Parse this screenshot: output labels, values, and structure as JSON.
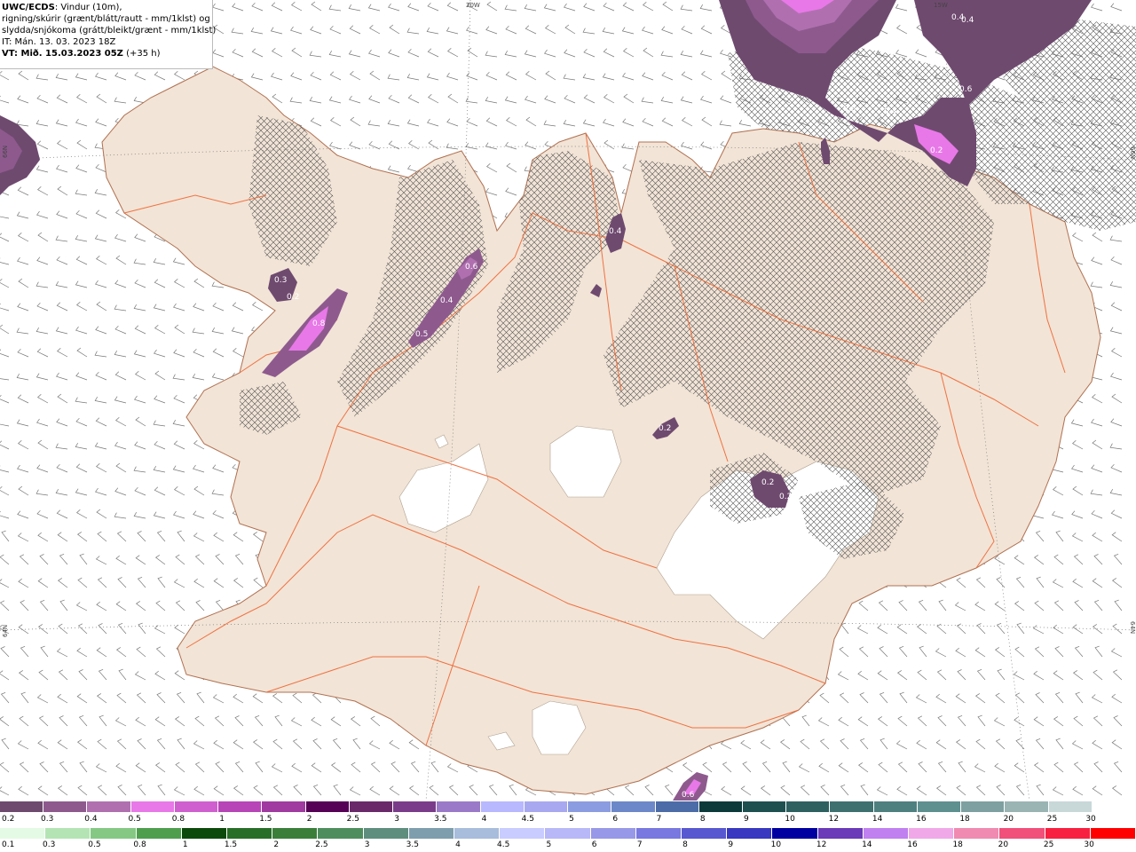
{
  "header": {
    "product_bold": "UWC/ECDS",
    "product_rest": ": Vindur (10m),",
    "line2": "rigning/skúrir (grænt/blátt/rautt - mm/1klst) og",
    "line3": "slydda/snjókoma (grátt/bleikt/grænt - mm/1klst)",
    "issue_time": "IT: Mán. 13. 03. 2023 18Z",
    "valid_label": "VT: Mið. 15.03.2023 05Z",
    "valid_offset": " (+35 h)"
  },
  "grid_labels": {
    "lon_20w": "20W",
    "lon_15w": "15W",
    "lat_66n_left": "66N",
    "lat_66n_right": "66N",
    "lat_64n_left": "64N",
    "lat_64n_right": "64N"
  },
  "precip_labels": [
    "0.3",
    "0.2",
    "0.8",
    "0.6",
    "0.4",
    "0.5",
    "0.4",
    "0.2",
    "0.2",
    "0.2",
    "0.6",
    "0.4",
    "0.5",
    "0.4",
    "0.2",
    "0.4",
    "0.6"
  ],
  "colors": {
    "land": "#f2e4d6",
    "sea": "#ffffff",
    "roads": "#ee6633",
    "coast": "#b07050",
    "glacier": "#ffffff",
    "barb": "#777777",
    "hatch": "#555555"
  },
  "legend_snow": {
    "labels": [
      "0.2",
      "0.3",
      "0.4",
      "0.5",
      "0.8",
      "1",
      "1.5",
      "2",
      "2.5",
      "3",
      "3.5",
      "4",
      "4.5",
      "5",
      "6",
      "7",
      "8",
      "9",
      "10",
      "12",
      "14",
      "16",
      "18",
      "20",
      "25",
      "30"
    ],
    "colors": [
      "#6f4a6f",
      "#8e5a8e",
      "#b070b0",
      "#e878e8",
      "#cf5fcf",
      "#b845b8",
      "#a03aa0",
      "#560056",
      "#6a2a6a",
      "#7a3c8a",
      "#9a7ac8",
      "#b8b8ff",
      "#a8a8f0",
      "#8c9ce0",
      "#6c88c8",
      "#4c6ca8",
      "#0c3a3a",
      "#1e5050",
      "#2e6060",
      "#3e7070",
      "#4e8080",
      "#5e9090",
      "#7ea0a0",
      "#9ab4b4",
      "#c8d8d8",
      "#ffffff"
    ]
  },
  "legend_rain": {
    "labels": [
      "0.1",
      "0.3",
      "0.5",
      "0.8",
      "1",
      "1.5",
      "2",
      "2.5",
      "3",
      "3.5",
      "4",
      "4.5",
      "5",
      "6",
      "7",
      "8",
      "9",
      "10",
      "12",
      "14",
      "16",
      "18",
      "20",
      "25",
      "30"
    ],
    "colors": [
      "#e4fae4",
      "#b4e4b4",
      "#84c884",
      "#4e9e4e",
      "#0c4a0c",
      "#286e28",
      "#3a7e3a",
      "#4e8e5e",
      "#5e8e7e",
      "#7e9eae",
      "#a8bcdc",
      "#c8ccff",
      "#b8b8f8",
      "#9898e8",
      "#7878e0",
      "#5858d0",
      "#3838c0",
      "#0000a0",
      "#6a3ab8",
      "#c080f0",
      "#f0a8e8",
      "#f08ab0",
      "#f0507a",
      "#f82040",
      "#ff0000"
    ]
  }
}
